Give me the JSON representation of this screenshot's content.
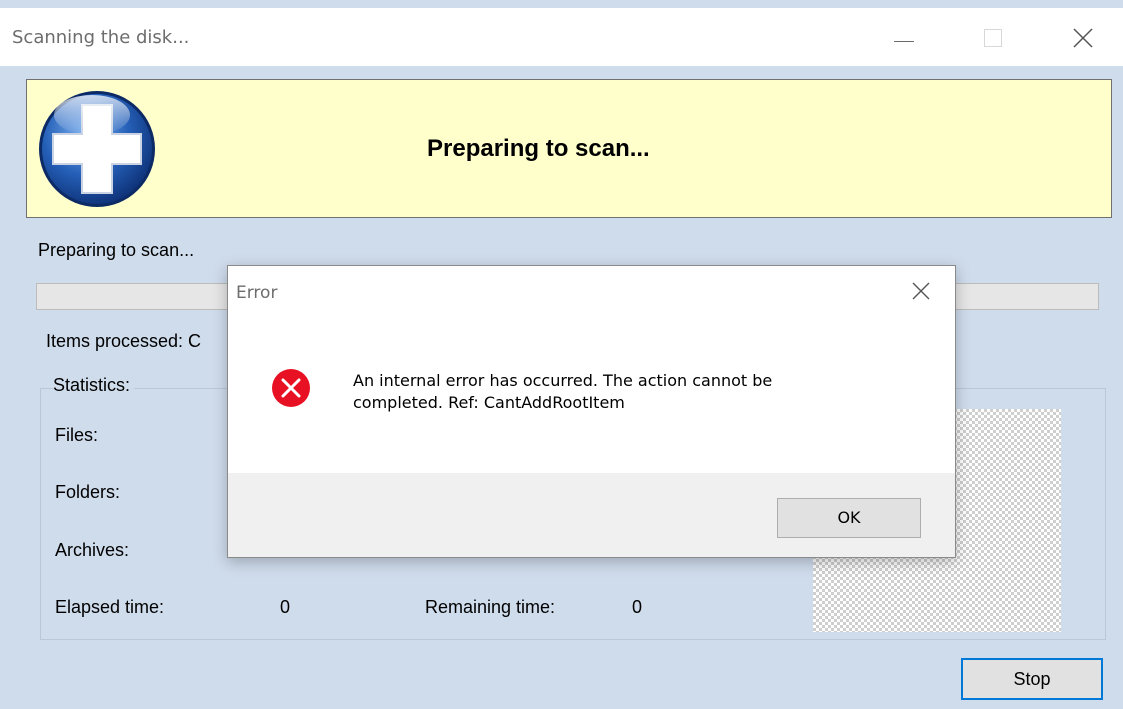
{
  "window": {
    "title": "Scanning the disk...",
    "controls": {
      "minimize": "minimize",
      "maximize": "maximize",
      "close": "close"
    }
  },
  "banner": {
    "title": "Preparing to scan...",
    "logo_icon": "medical-cross-icon"
  },
  "scan": {
    "status": "Preparing to scan...",
    "progress_fraction": 0,
    "items_processed": "Items processed: C"
  },
  "statistics": {
    "title": "Statistics:",
    "files_label": "Files:",
    "folders_label": "Folders:",
    "archives_label": "Archives:",
    "elapsed_label": "Elapsed time:",
    "elapsed_value": "0",
    "remaining_label": "Remaining time:",
    "remaining_value": "0"
  },
  "stop_button": "Stop",
  "dialog": {
    "title": "Error",
    "message_line1": "An internal error has occurred. The action cannot be",
    "message_line2": "completed. Ref: CantAddRootItem",
    "ok_button": "OK",
    "icon": "error-icon",
    "icon_color": "#e81123"
  },
  "colors": {
    "window_bg": "#cfdcec",
    "banner_bg": "#ffffcc",
    "accent": "#0078d7"
  }
}
